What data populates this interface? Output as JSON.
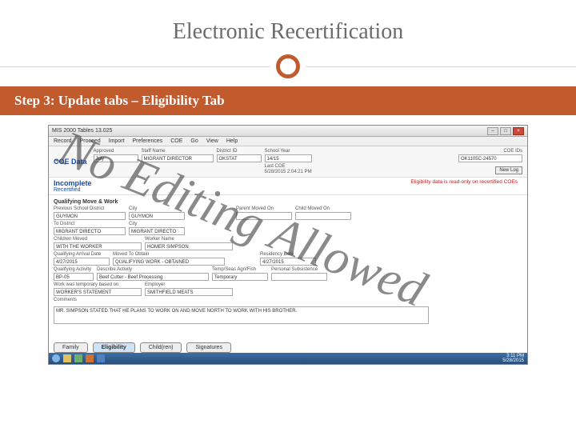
{
  "slide": {
    "title": "Electronic Recertification",
    "step_label": "Step 3: Update tabs – Eligibility Tab"
  },
  "watermark": "No Editing Allowed",
  "app": {
    "window_title": "MIS 2000 Tables 13.025",
    "menu": [
      "Record",
      "Proceed",
      "Import",
      "Preferences",
      "COE",
      "Go",
      "View",
      "Help"
    ],
    "coe_label": "COE Data",
    "top_fields": {
      "approved_label": "Approved",
      "approved_value": "July",
      "staffname_label": "Staff Name",
      "staffname_value": "MIGRANT DIRECTOR",
      "district_label": "District ID",
      "district_value": "OKSTAT",
      "schoolyear_label": "School Year",
      "schoolyear_value": "14/15",
      "scan_label": "Last COE",
      "scan_value": "5/28/2015 2:04:21 PM"
    },
    "right_panel": {
      "coeids_label": "COE IDs",
      "coeids_value": "OK1105C-24570",
      "newlog_label": "New Log"
    },
    "status": {
      "incomplete": "Incomplete",
      "recertified": "Recertified",
      "readonly_note": "Eligibility data is read-only on recertified COEs"
    },
    "move": {
      "section": "Qualifying Move & Work",
      "prev_district_label": "Previous School District",
      "prev_district_value": "GUYMON",
      "prev_city_label": "City",
      "prev_city_value": "GUYMON",
      "to_district_label": "To District",
      "to_district_value": "MIGRANT DIRECTO",
      "to_city_label": "City",
      "to_city_value": "MIGRANT DIRECTO",
      "moved_on_label": "Parent Moved On",
      "moved_on_value": "",
      "child_moved_label": "Child Moved On",
      "child_moved_value": ""
    },
    "child_moved": {
      "label": "Children Moved",
      "value": "WITH THE WORKER",
      "worker_label": "Worker Name",
      "worker_value": "HOMER SIMPSON"
    },
    "qad": {
      "qad_label": "Qualifying Arrival Date",
      "qad_value": "4/27/2015",
      "mto_label": "Moved To Obtain",
      "mto_value": "QUALIFYING WORK - OBTAINED",
      "res_label": "Residency Date",
      "res_value": "4/27/2015"
    },
    "activity": {
      "qa_label": "Qualifying Activity",
      "qa_value": "BP-05",
      "describe_label": "Describe Activity",
      "describe_value": "Beef Cutter - Beef Processing",
      "temp_label": "Temp/Seas Agri/Fish",
      "temp_value": "Temporary",
      "ps_label": "Personal Subsistence",
      "ps_value": ""
    },
    "employer": {
      "tempbasis_label": "Work was temporary based on",
      "tempbasis_value": "WORKER'S STATEMENT",
      "employer_label": "Employer",
      "employer_value": "SMITHFIELD MEATS"
    },
    "comments": {
      "label": "Comments",
      "text": "MR. SIMPSON STATED THAT HE PLANS TO WORK ON AND MOVE NORTH TO WORK WITH HIS BROTHER."
    },
    "tabs": {
      "family": "Family",
      "eligibility": "Eligibility",
      "children": "Child(ren)",
      "signatures": "Signatures"
    }
  },
  "taskbar": {
    "time": "3:11 PM",
    "date": "5/28/2015"
  }
}
